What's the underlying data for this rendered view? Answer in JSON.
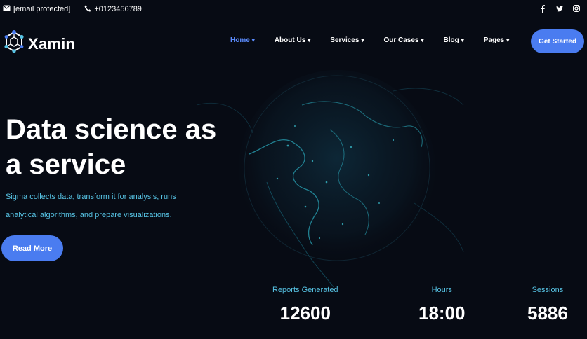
{
  "topbar": {
    "email": "[email protected]",
    "phone": "+0123456789",
    "social": [
      "facebook-icon",
      "twitter-icon",
      "instagram-icon"
    ]
  },
  "brand": {
    "name": "Xamin",
    "accent": "#4a7cf0",
    "highlight": "#57c4e5"
  },
  "nav": {
    "items": [
      {
        "label": "Home",
        "active": true
      },
      {
        "label": "About Us",
        "active": false
      },
      {
        "label": "Services",
        "active": false
      },
      {
        "label": "Our Cases",
        "active": false
      },
      {
        "label": "Blog",
        "active": false
      },
      {
        "label": "Pages",
        "active": false
      }
    ],
    "cta": "Get Started"
  },
  "hero": {
    "title_line1": "Data science as",
    "title_line2": "a service",
    "desc_line1": "Sigma collects data, transform it for analysis, runs",
    "desc_line2": "analytical algorithms, and prepare visualizations.",
    "button": "Read More"
  },
  "stats": [
    {
      "label": "Reports Generated",
      "value": "12600"
    },
    {
      "label": "Hours",
      "value": "18:00"
    },
    {
      "label": "Sessions",
      "value": "5886"
    }
  ]
}
